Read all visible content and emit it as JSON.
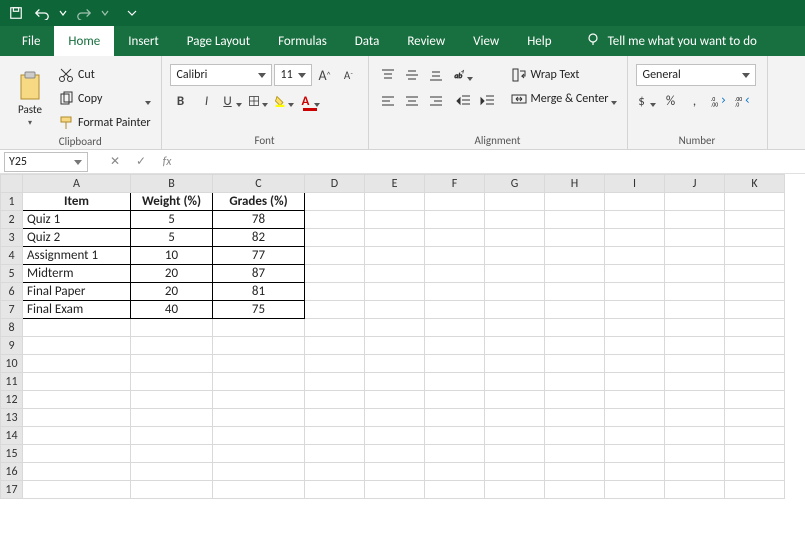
{
  "qat": {
    "save": "save-icon",
    "undo": "undo-icon",
    "redo": "redo-icon"
  },
  "tabs": [
    "File",
    "Home",
    "Insert",
    "Page Layout",
    "Formulas",
    "Data",
    "Review",
    "View",
    "Help"
  ],
  "active_tab": "Home",
  "tellme": "Tell me what you want to do",
  "ribbon": {
    "clipboard": {
      "paste": "Paste",
      "cut": "Cut",
      "copy": "Copy",
      "painter": "Format Painter",
      "label": "Clipboard"
    },
    "font": {
      "name": "Calibri",
      "size": "11",
      "bold": "B",
      "italic": "I",
      "underline": "U",
      "incA": "A",
      "decA": "A",
      "label": "Font"
    },
    "alignment": {
      "wrap": "Wrap Text",
      "merge": "Merge & Center",
      "label": "Alignment"
    },
    "number": {
      "format": "General",
      "dollar": "$",
      "pct": "%",
      "comma": ",",
      "label": "Number"
    }
  },
  "namebox": "Y25",
  "fx": "fx",
  "columns": [
    "A",
    "B",
    "C",
    "D",
    "E",
    "F",
    "G",
    "H",
    "I",
    "J",
    "K"
  ],
  "rows_visible": 17,
  "data": {
    "headers": [
      "Item",
      "Weight (%)",
      "Grades (%)"
    ],
    "rows": [
      [
        "Quiz 1",
        "5",
        "78"
      ],
      [
        "Quiz 2",
        "5",
        "82"
      ],
      [
        "Assignment 1",
        "10",
        "77"
      ],
      [
        "Midterm",
        "20",
        "87"
      ],
      [
        "Final Paper",
        "20",
        "81"
      ],
      [
        "Final Exam",
        "40",
        "75"
      ]
    ]
  }
}
